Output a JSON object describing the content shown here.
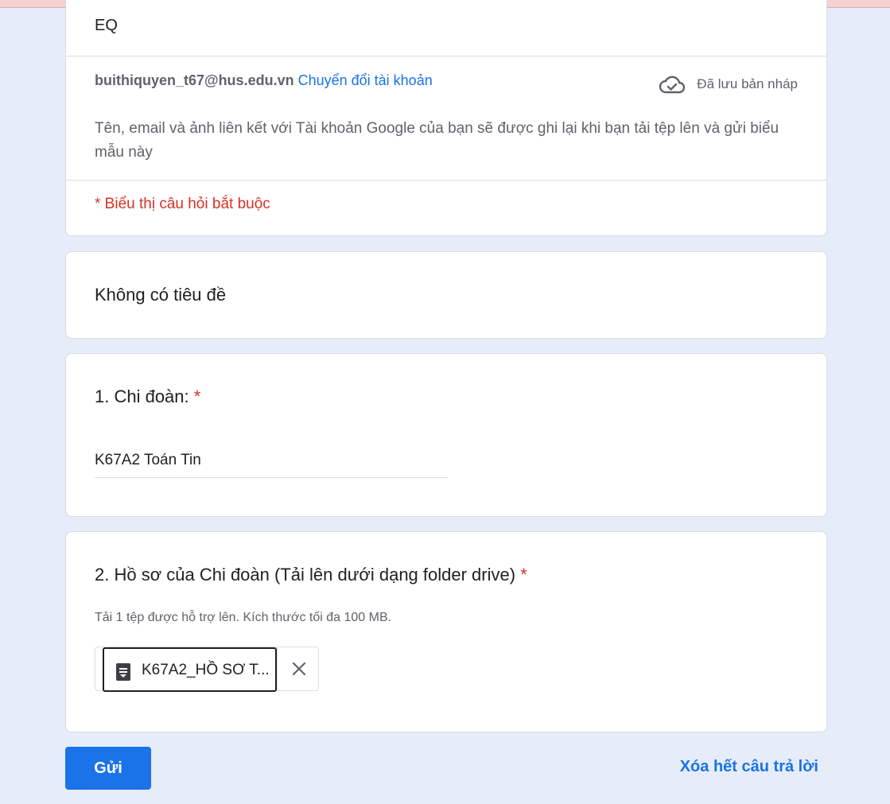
{
  "form": {
    "title": "EQ",
    "account": {
      "email": "buithiquyen_t67@hus.edu.vn",
      "switch_label": "Chuyển đổi tài khoản",
      "saved_status": "Đã lưu bản nháp"
    },
    "notice": "Tên, email và ảnh liên kết với Tài khoản Google của bạn sẽ được ghi lại khi bạn tải tệp lên và gửi biểu mẫu này",
    "required_note": "* Biểu thị câu hỏi bắt buộc"
  },
  "section": {
    "title": "Không có tiêu đề"
  },
  "questions": [
    {
      "title": "1. Chi đoàn:",
      "required_mark": "*",
      "answer": "K67A2 Toán Tin"
    },
    {
      "title": "2. Hồ sơ của Chi đoàn (Tải lên dưới dạng folder drive)",
      "required_mark": "*",
      "hint": "Tải 1 tệp được hỗ trợ lên. Kích thước tối đa 100 MB.",
      "file_name": "K67A2_HỒ SƠ T...",
      "file_icon": "document-icon",
      "remove_icon": "close-icon"
    }
  ],
  "actions": {
    "submit_label": "Gửi",
    "clear_label": "Xóa hết câu trả lời"
  },
  "colors": {
    "accent": "#1a73e8",
    "required": "#d93025",
    "background": "#e6edf9"
  }
}
